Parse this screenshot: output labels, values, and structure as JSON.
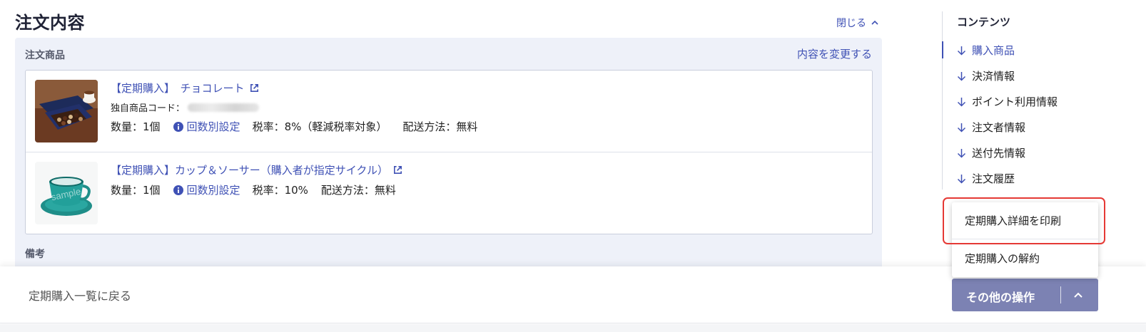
{
  "header": {
    "title": "注文内容",
    "collapse_label": "閉じる"
  },
  "order_items": {
    "section_label": "注文商品",
    "change_label": "内容を変更する",
    "items": [
      {
        "title": "【定期購入】　チョコレート",
        "code_label": "独自商品コード：",
        "quantity": "数量：1個",
        "schedule_link": "回数別設定",
        "tax": "税率：8%（軽減税率対象）",
        "shipping": "配送方法：無料"
      },
      {
        "title": "【定期購入】カップ＆ソーサー（購入者が指定サイクル）",
        "quantity": "数量：1個",
        "schedule_link": "回数別設定",
        "tax": "税率：10%",
        "shipping": "配送方法：無料",
        "watermark": "sample"
      }
    ],
    "remarks_label": "備考"
  },
  "toc": {
    "title": "コンテンツ",
    "items": [
      {
        "label": "購入商品",
        "active": true
      },
      {
        "label": "決済情報",
        "active": false
      },
      {
        "label": "ポイント利用情報",
        "active": false
      },
      {
        "label": "注文者情報",
        "active": false
      },
      {
        "label": "送付先情報",
        "active": false
      },
      {
        "label": "注文履歴",
        "active": false
      }
    ]
  },
  "actions_menu": {
    "items": [
      "定期購入詳細を印刷",
      "定期購入の解約"
    ]
  },
  "footer": {
    "back_label": "定期購入一覧に戻る",
    "ops_label": "その他の操作"
  },
  "colors": {
    "accent": "#3f51b5",
    "button": "#7c82b3",
    "highlight": "#e53935",
    "panel": "#eef1f9"
  }
}
